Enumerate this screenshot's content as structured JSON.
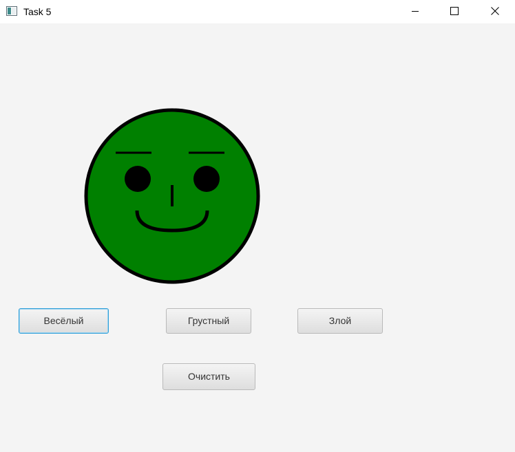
{
  "window": {
    "title": "Task 5"
  },
  "titlebar_controls": {
    "minimize_icon": "minimize-icon",
    "maximize_icon": "maximize-icon",
    "close_icon": "close-icon"
  },
  "face": {
    "expression": "happy",
    "fill_color": "#008000",
    "outline_color": "#000000"
  },
  "buttons": {
    "happy": "Весёлый",
    "sad": "Грустный",
    "angry": "Злой",
    "clear": "Очистить"
  },
  "colors": {
    "background": "#f4f4f4",
    "focus_ring": "#2f9fd8"
  }
}
